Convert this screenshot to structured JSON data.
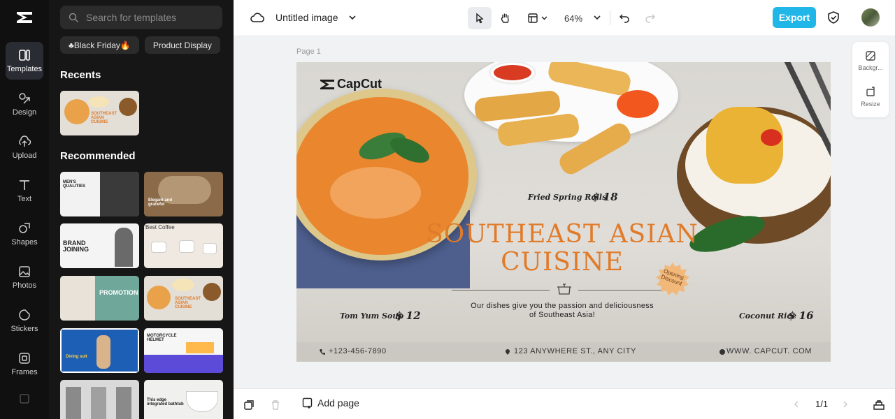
{
  "rail": {
    "items": [
      {
        "label": "Templates",
        "icon": "templates-icon",
        "active": true
      },
      {
        "label": "Design",
        "icon": "design-icon"
      },
      {
        "label": "Upload",
        "icon": "upload-icon"
      },
      {
        "label": "Text",
        "icon": "text-icon"
      },
      {
        "label": "Shapes",
        "icon": "shapes-icon"
      },
      {
        "label": "Photos",
        "icon": "photos-icon"
      },
      {
        "label": "Stickers",
        "icon": "stickers-icon"
      },
      {
        "label": "Frames",
        "icon": "frames-icon"
      }
    ]
  },
  "panel": {
    "search_placeholder": "Search for templates",
    "chips": [
      "♣Black Friday🔥",
      "Product Display"
    ],
    "recents_title": "Recents",
    "recommended_title": "Recommended",
    "thumbs": [
      {
        "label": "MEN'S QUALITIES",
        "bg": "#f2f2f2",
        "fg": "#222"
      },
      {
        "label": "Elegant and graceful",
        "bg": "#8a6a48",
        "fg": "#fff"
      },
      {
        "label": "BRAND JOINING",
        "bg": "#f4f4f4",
        "fg": "#222"
      },
      {
        "label": "Best Coffee",
        "bg": "#efe9e2",
        "fg": "#333"
      },
      {
        "label": "PROMOTION",
        "bg": "#6fa89a",
        "fg": "#fff"
      },
      {
        "label": "SOUTHEAST ASIAN CUISINE",
        "bg": "#e3ded6",
        "fg": "#e07b2a"
      },
      {
        "label": "Diving suit",
        "bg": "#1e5fb6",
        "fg": "#fff"
      },
      {
        "label": "MOTORCYCLE HELMET",
        "bg": "#f6f6f6",
        "fg": "#222"
      },
      {
        "label": "",
        "bg": "#d9d9d9",
        "fg": "#333"
      },
      {
        "label": "This edge integrated bathtub",
        "bg": "#f0f0ee",
        "fg": "#222"
      }
    ]
  },
  "topbar": {
    "doc_title": "Untitled image",
    "zoom": "64%",
    "export_label": "Export"
  },
  "workspace": {
    "page_label": "Page 1"
  },
  "side_tools": {
    "background_label": "Backgr...",
    "resize_label": "Resize"
  },
  "design": {
    "brand": "CapCut",
    "title_line1": "SOUTHEAST ASIAN",
    "title_line2": "CUISINE",
    "items": [
      {
        "name": "Fried Spring Rolls",
        "price": "$ 18"
      },
      {
        "name": "Tom Yum Soup",
        "price": "$ 12"
      },
      {
        "name": "Coconut Rice",
        "price": "$ 16"
      }
    ],
    "description_line1": "Our dishes give you the passion and deliciousness",
    "description_line2": "of Southeast Asia!",
    "badge_line1": "Opening",
    "badge_line2": "Discount",
    "phone": "+123-456-7890",
    "address": "123 ANYWHERE ST., ANY CITY",
    "website": "WWW. CAPCUT. COM",
    "accent_color": "#e07b2a"
  },
  "bottombar": {
    "add_page_label": "Add page",
    "pager": "1/1"
  }
}
